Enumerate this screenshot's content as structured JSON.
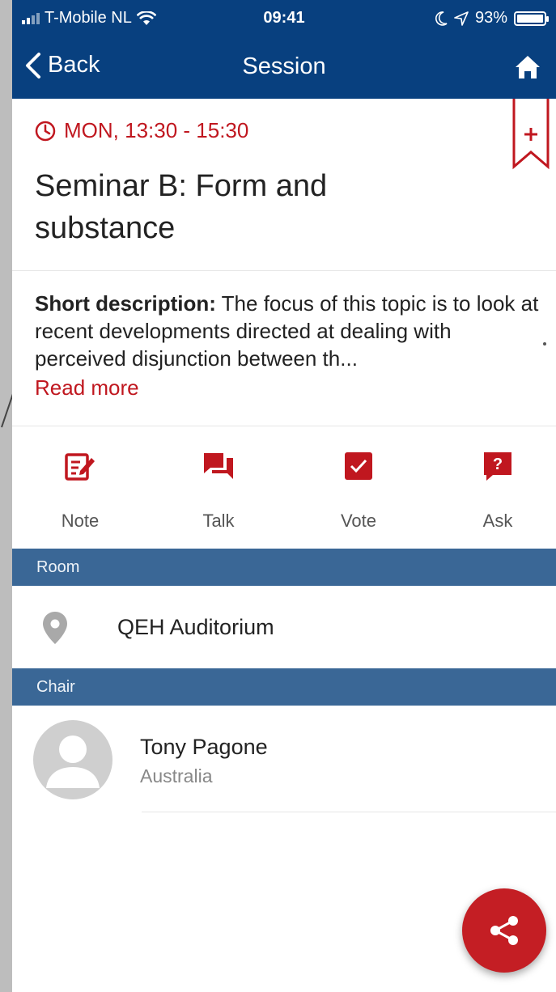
{
  "status_bar": {
    "carrier": "T-Mobile NL",
    "time": "09:41",
    "battery": "93%"
  },
  "nav": {
    "back_label": "Back",
    "title": "Session"
  },
  "session": {
    "time": "MON, 13:30 - 15:30",
    "title": "Seminar B: Form and substance",
    "description_label": "Short description:",
    "description_text": "The focus of this topic is to look at recent developments directed at dealing with perceived disjunction between th...",
    "read_more": "Read more"
  },
  "actions": [
    {
      "label": "Note",
      "icon": "note-edit-icon"
    },
    {
      "label": "Talk",
      "icon": "chat-icon"
    },
    {
      "label": "Vote",
      "icon": "checkbox-icon"
    },
    {
      "label": "Ask",
      "icon": "question-icon"
    }
  ],
  "room": {
    "header": "Room",
    "name": "QEH Auditorium"
  },
  "chair": {
    "header": "Chair",
    "name": "Tony Pagone",
    "country": "Australia"
  },
  "colors": {
    "nav_blue": "#08407f",
    "section_blue": "#3a6796",
    "accent_red": "#c0171f"
  }
}
